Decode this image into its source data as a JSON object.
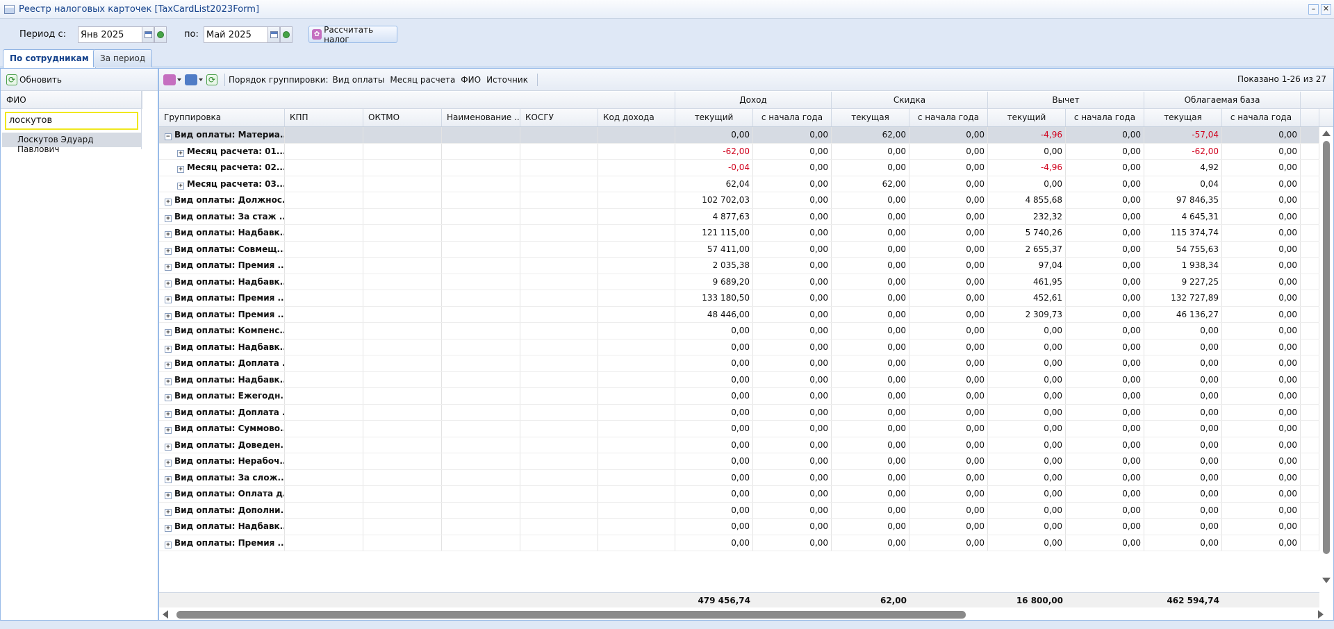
{
  "window": {
    "title": "Реестр налоговых карточек [TaxCardList2023Form]"
  },
  "period": {
    "from_label": "Период с:",
    "from_value": "Янв 2025",
    "to_label": "по:",
    "to_value": "Май 2025",
    "calc_button": "Рассчитать налог"
  },
  "tabs": [
    {
      "label": "По сотрудникам"
    },
    {
      "label": "За период"
    }
  ],
  "left": {
    "refresh_label": "Обновить",
    "column_header": "ФИО",
    "filter_value": "лоскутов",
    "person": "Лоскутов Эдуард Павлович"
  },
  "main": {
    "grouping_label": "Порядок группировки:",
    "grouping_items": [
      "Вид оплаты",
      "Месяц расчета",
      "ФИО",
      "Источник"
    ],
    "shown_text": "Показано 1-26 из 27"
  },
  "grid": {
    "header_groups": [
      "Доход",
      "Скидка",
      "Вычет",
      "Облагаемая база"
    ],
    "columns": [
      "Группировка",
      "КПП",
      "ОКТМО",
      "Наименование ...",
      "КОСГУ",
      "Код дохода",
      "текущий",
      "с начала года",
      "текущая",
      "с начала года",
      "текущий",
      "с начала года",
      "текущая",
      "с начала года"
    ],
    "rows": [
      {
        "label": "Вид оплаты: Материа...",
        "level": 0,
        "expander": "−",
        "values": [
          "0,00",
          "0,00",
          "62,00",
          "0,00",
          "-4,96",
          "0,00",
          "-57,04",
          "0,00"
        ]
      },
      {
        "label": "Месяц расчета: 01....",
        "level": 1,
        "expander": "+",
        "values": [
          "-62,00",
          "0,00",
          "0,00",
          "0,00",
          "0,00",
          "0,00",
          "-62,00",
          "0,00"
        ]
      },
      {
        "label": "Месяц расчета: 02....",
        "level": 1,
        "expander": "+",
        "values": [
          "-0,04",
          "0,00",
          "0,00",
          "0,00",
          "-4,96",
          "0,00",
          "4,92",
          "0,00"
        ]
      },
      {
        "label": "Месяц расчета: 03....",
        "level": 1,
        "expander": "+",
        "values": [
          "62,04",
          "0,00",
          "62,00",
          "0,00",
          "0,00",
          "0,00",
          "0,04",
          "0,00"
        ]
      },
      {
        "label": "Вид оплаты: Должнос...",
        "level": 0,
        "expander": "+",
        "values": [
          "102 702,03",
          "0,00",
          "0,00",
          "0,00",
          "4 855,68",
          "0,00",
          "97 846,35",
          "0,00"
        ]
      },
      {
        "label": "Вид оплаты: За стаж ...",
        "level": 0,
        "expander": "+",
        "values": [
          "4 877,63",
          "0,00",
          "0,00",
          "0,00",
          "232,32",
          "0,00",
          "4 645,31",
          "0,00"
        ]
      },
      {
        "label": "Вид оплаты: Надбавк...",
        "level": 0,
        "expander": "+",
        "values": [
          "121 115,00",
          "0,00",
          "0,00",
          "0,00",
          "5 740,26",
          "0,00",
          "115 374,74",
          "0,00"
        ]
      },
      {
        "label": "Вид оплаты: Совмещ...",
        "level": 0,
        "expander": "+",
        "values": [
          "57 411,00",
          "0,00",
          "0,00",
          "0,00",
          "2 655,37",
          "0,00",
          "54 755,63",
          "0,00"
        ]
      },
      {
        "label": "Вид оплаты: Премия ...",
        "level": 0,
        "expander": "+",
        "values": [
          "2 035,38",
          "0,00",
          "0,00",
          "0,00",
          "97,04",
          "0,00",
          "1 938,34",
          "0,00"
        ]
      },
      {
        "label": "Вид оплаты: Надбавк...",
        "level": 0,
        "expander": "+",
        "values": [
          "9 689,20",
          "0,00",
          "0,00",
          "0,00",
          "461,95",
          "0,00",
          "9 227,25",
          "0,00"
        ]
      },
      {
        "label": "Вид оплаты: Премия ...",
        "level": 0,
        "expander": "+",
        "values": [
          "133 180,50",
          "0,00",
          "0,00",
          "0,00",
          "452,61",
          "0,00",
          "132 727,89",
          "0,00"
        ]
      },
      {
        "label": "Вид оплаты: Премия ...",
        "level": 0,
        "expander": "+",
        "values": [
          "48 446,00",
          "0,00",
          "0,00",
          "0,00",
          "2 309,73",
          "0,00",
          "46 136,27",
          "0,00"
        ]
      },
      {
        "label": "Вид оплаты: Компенс...",
        "level": 0,
        "expander": "+",
        "values": [
          "0,00",
          "0,00",
          "0,00",
          "0,00",
          "0,00",
          "0,00",
          "0,00",
          "0,00"
        ]
      },
      {
        "label": "Вид оплаты: Надбавк...",
        "level": 0,
        "expander": "+",
        "values": [
          "0,00",
          "0,00",
          "0,00",
          "0,00",
          "0,00",
          "0,00",
          "0,00",
          "0,00"
        ]
      },
      {
        "label": "Вид оплаты: Доплата ...",
        "level": 0,
        "expander": "+",
        "values": [
          "0,00",
          "0,00",
          "0,00",
          "0,00",
          "0,00",
          "0,00",
          "0,00",
          "0,00"
        ]
      },
      {
        "label": "Вид оплаты: Надбавк...",
        "level": 0,
        "expander": "+",
        "values": [
          "0,00",
          "0,00",
          "0,00",
          "0,00",
          "0,00",
          "0,00",
          "0,00",
          "0,00"
        ]
      },
      {
        "label": "Вид оплаты: Ежегодн...",
        "level": 0,
        "expander": "+",
        "values": [
          "0,00",
          "0,00",
          "0,00",
          "0,00",
          "0,00",
          "0,00",
          "0,00",
          "0,00"
        ]
      },
      {
        "label": "Вид оплаты: Доплата ...",
        "level": 0,
        "expander": "+",
        "values": [
          "0,00",
          "0,00",
          "0,00",
          "0,00",
          "0,00",
          "0,00",
          "0,00",
          "0,00"
        ]
      },
      {
        "label": "Вид оплаты: Суммово...",
        "level": 0,
        "expander": "+",
        "values": [
          "0,00",
          "0,00",
          "0,00",
          "0,00",
          "0,00",
          "0,00",
          "0,00",
          "0,00"
        ]
      },
      {
        "label": "Вид оплаты: Доведен...",
        "level": 0,
        "expander": "+",
        "values": [
          "0,00",
          "0,00",
          "0,00",
          "0,00",
          "0,00",
          "0,00",
          "0,00",
          "0,00"
        ]
      },
      {
        "label": "Вид оплаты: Нерабоч...",
        "level": 0,
        "expander": "+",
        "values": [
          "0,00",
          "0,00",
          "0,00",
          "0,00",
          "0,00",
          "0,00",
          "0,00",
          "0,00"
        ]
      },
      {
        "label": "Вид оплаты: За слож...",
        "level": 0,
        "expander": "+",
        "values": [
          "0,00",
          "0,00",
          "0,00",
          "0,00",
          "0,00",
          "0,00",
          "0,00",
          "0,00"
        ]
      },
      {
        "label": "Вид оплаты: Оплата д...",
        "level": 0,
        "expander": "+",
        "values": [
          "0,00",
          "0,00",
          "0,00",
          "0,00",
          "0,00",
          "0,00",
          "0,00",
          "0,00"
        ]
      },
      {
        "label": "Вид оплаты: Дополни...",
        "level": 0,
        "expander": "+",
        "values": [
          "0,00",
          "0,00",
          "0,00",
          "0,00",
          "0,00",
          "0,00",
          "0,00",
          "0,00"
        ]
      },
      {
        "label": "Вид оплаты: Надбавк...",
        "level": 0,
        "expander": "+",
        "values": [
          "0,00",
          "0,00",
          "0,00",
          "0,00",
          "0,00",
          "0,00",
          "0,00",
          "0,00"
        ]
      },
      {
        "label": "Вид оплаты: Премия ...",
        "level": 0,
        "expander": "+",
        "values": [
          "0,00",
          "0,00",
          "0,00",
          "0,00",
          "0,00",
          "0,00",
          "0,00",
          "0,00"
        ]
      }
    ],
    "totals": [
      "479 456,74",
      "62,00",
      "16 800,00",
      "462 594,74"
    ]
  },
  "colors": {
    "negative": "#d0001c",
    "selected_row": "#d6dbe3",
    "accent": "#15428b",
    "filter_border": "#f0e81e"
  }
}
